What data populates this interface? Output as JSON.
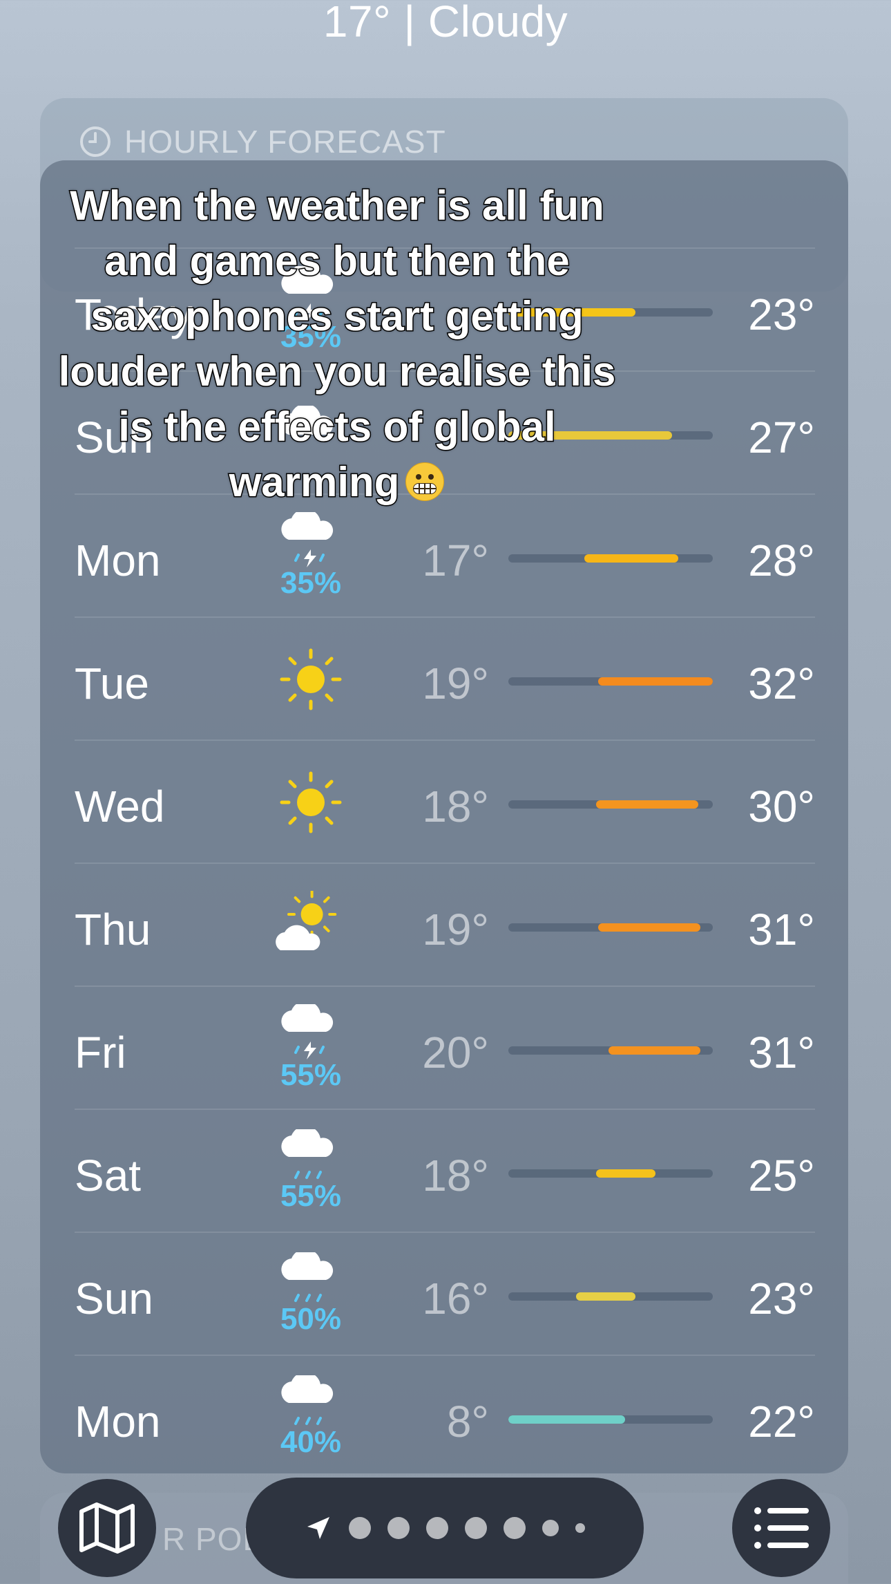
{
  "header": {
    "summary": "17° | Cloudy"
  },
  "hourly": {
    "title": "HOURLY FORECAST"
  },
  "bottom": {
    "label": "R POL"
  },
  "caption": {
    "line1": "When the weather is all fun",
    "line2": "and games but then the",
    "line3": "saxophones start getting",
    "line4": "louder when you realise this",
    "line5": "is the effects of global",
    "line6": "warming",
    "emoji": "grimacing-face"
  },
  "daily": [
    {
      "day": "Today",
      "icon": "cloud-thunder-rain",
      "precip": "35%",
      "low": "",
      "high": "23°",
      "fill_from": 0.0,
      "fill_to": 0.62,
      "fill_color": "#f5c518"
    },
    {
      "day": "Sun",
      "icon": "cloud",
      "precip": "",
      "low": "",
      "high": "27°",
      "fill_from": 0.0,
      "fill_to": 0.8,
      "fill_color": "#e8c83a"
    },
    {
      "day": "Mon",
      "icon": "cloud-thunder-rain",
      "precip": "35%",
      "low": "17°",
      "high": "28°",
      "fill_from": 0.37,
      "fill_to": 0.83,
      "fill_color": "#f7b617"
    },
    {
      "day": "Tue",
      "icon": "sun",
      "precip": "",
      "low": "19°",
      "high": "32°",
      "fill_from": 0.44,
      "fill_to": 1.0,
      "fill_color": "#f48b1e"
    },
    {
      "day": "Wed",
      "icon": "sun",
      "precip": "",
      "low": "18°",
      "high": "30°",
      "fill_from": 0.43,
      "fill_to": 0.93,
      "fill_color": "#f4951f"
    },
    {
      "day": "Thu",
      "icon": "sun-behind-cloud",
      "precip": "",
      "low": "19°",
      "high": "31°",
      "fill_from": 0.44,
      "fill_to": 0.94,
      "fill_color": "#f4911f"
    },
    {
      "day": "Fri",
      "icon": "cloud-thunder-rain",
      "precip": "55%",
      "low": "20°",
      "high": "31°",
      "fill_from": 0.49,
      "fill_to": 0.94,
      "fill_color": "#f4921f"
    },
    {
      "day": "Sat",
      "icon": "cloud-rain",
      "precip": "55%",
      "low": "18°",
      "high": "25°",
      "fill_from": 0.43,
      "fill_to": 0.72,
      "fill_color": "#f5c21a"
    },
    {
      "day": "Sun",
      "icon": "cloud-rain",
      "precip": "50%",
      "low": "16°",
      "high": "23°",
      "fill_from": 0.33,
      "fill_to": 0.62,
      "fill_color": "#e6cf45"
    },
    {
      "day": "Mon",
      "icon": "cloud-rain",
      "precip": "40%",
      "low": "8°",
      "high": "22°",
      "fill_from": 0.0,
      "fill_to": 0.57,
      "fill_color": "#6fd0c8"
    }
  ],
  "controls": {
    "map_icon": "map-icon",
    "list_icon": "list-icon",
    "location_icon": "location-arrow-icon",
    "page_dots": 7
  },
  "colors": {
    "precip": "#5cc8f5",
    "sun": "#f7d117"
  }
}
